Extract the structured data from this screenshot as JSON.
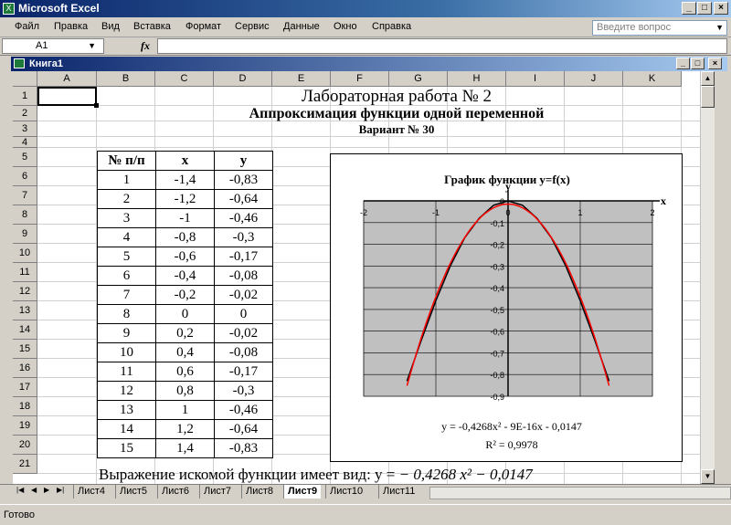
{
  "window": {
    "title": "Microsoft Excel"
  },
  "menu": [
    "Файл",
    "Правка",
    "Вид",
    "Вставка",
    "Формат",
    "Сервис",
    "Данные",
    "Окно",
    "Справка"
  ],
  "ask_placeholder": "Введите вопрос",
  "namebox": "A1",
  "fx_label": "fx",
  "workbook_title": "Книга1",
  "columns": [
    "A",
    "B",
    "C",
    "D",
    "E",
    "F",
    "G",
    "H",
    "I",
    "J",
    "K"
  ],
  "rows": [
    "1",
    "2",
    "3",
    "4",
    "5",
    "6",
    "7",
    "8",
    "9",
    "10",
    "11",
    "12",
    "13",
    "14",
    "15",
    "16",
    "17",
    "18",
    "19",
    "20",
    "21"
  ],
  "sheet": {
    "title": "Лабораторная работа № 2",
    "subtitle": "Аппроксимация  функции одной переменной",
    "variant": "Вариант № 30",
    "table_headers": [
      "№ п/п",
      "x",
      "y"
    ],
    "table_rows": [
      [
        "1",
        "-1,4",
        "-0,83"
      ],
      [
        "2",
        "-1,2",
        "-0,64"
      ],
      [
        "3",
        "-1",
        "-0,46"
      ],
      [
        "4",
        "-0,8",
        "-0,3"
      ],
      [
        "5",
        "-0,6",
        "-0,17"
      ],
      [
        "6",
        "-0,4",
        "-0,08"
      ],
      [
        "7",
        "-0,2",
        "-0,02"
      ],
      [
        "8",
        "0",
        "0"
      ],
      [
        "9",
        "0,2",
        "-0,02"
      ],
      [
        "10",
        "0,4",
        "-0,08"
      ],
      [
        "11",
        "0,6",
        "-0,17"
      ],
      [
        "12",
        "0,8",
        "-0,3"
      ],
      [
        "13",
        "1",
        "-0,46"
      ],
      [
        "14",
        "1,2",
        "-0,64"
      ],
      [
        "15",
        "1,4",
        "-0,83"
      ]
    ],
    "expression_prefix": "Выражение искомой функции имеет вид: y = ",
    "expression_formula": "− 0,4268  x² − 0,0147"
  },
  "chart_data": {
    "type": "line",
    "title": "График функции y=f(x)",
    "xlabel": "x",
    "ylabel": "y",
    "xlim": [
      -2,
      2
    ],
    "ylim": [
      -0.9,
      0
    ],
    "x_ticks": [
      "-2",
      "-1",
      "0",
      "1",
      "2"
    ],
    "y_ticks": [
      "0",
      "-0,1",
      "-0,2",
      "-0,3",
      "-0,4",
      "-0,5",
      "-0,6",
      "-0,7",
      "-0,8",
      "-0,9"
    ],
    "series": [
      {
        "x": [
          -1.4,
          -1.2,
          -1,
          -0.8,
          -0.6,
          -0.4,
          -0.2,
          0,
          0.2,
          0.4,
          0.6,
          0.8,
          1,
          1.2,
          1.4
        ],
        "y": [
          -0.83,
          -0.64,
          -0.46,
          -0.3,
          -0.17,
          -0.08,
          -0.02,
          0,
          -0.02,
          -0.08,
          -0.17,
          -0.3,
          -0.46,
          -0.64,
          -0.83
        ],
        "color": "#000000"
      },
      {
        "trend": {
          "a": -0.4268,
          "b": 0,
          "c": -0.0147
        },
        "color": "#ff0000"
      }
    ],
    "trend_equation": "y = -0,4268x² - 9E-16x - 0,0147",
    "r_squared": "R² = 0,9978",
    "plot_bg": "#c0c0c0",
    "grid": true
  },
  "sheet_tabs": [
    "Лист4",
    "Лист5",
    "Лист6",
    "Лист7",
    "Лист8",
    "Лист9",
    "Лист10",
    "Лист11"
  ],
  "active_tab": "Лист9",
  "status": "Готово"
}
